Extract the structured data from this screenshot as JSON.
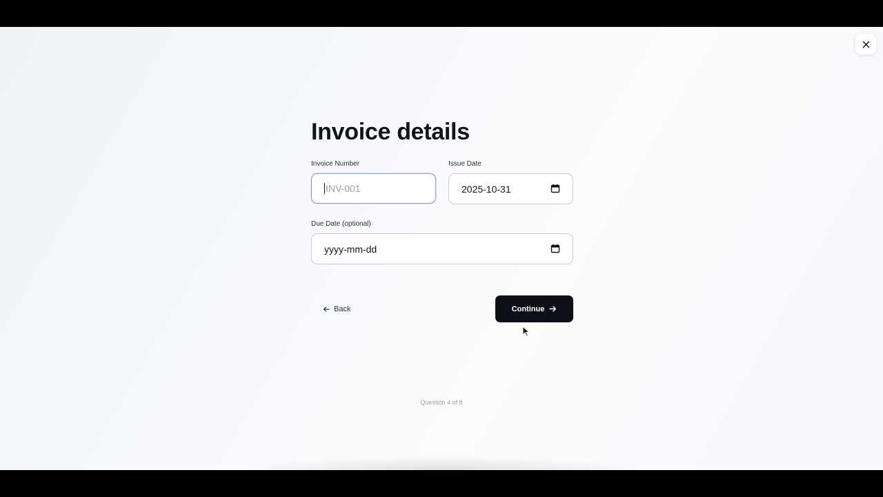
{
  "form": {
    "title": "Invoice details",
    "invoice_number": {
      "label": "Invoice Number",
      "placeholder": "INV-001",
      "value": ""
    },
    "issue_date": {
      "label": "Issue Date",
      "value": "2025-10-31"
    },
    "due_date": {
      "label": "Due Date (optional)",
      "placeholder": "yyyy-mm-dd",
      "value": ""
    }
  },
  "actions": {
    "back_label": "Back",
    "continue_label": "Continue"
  },
  "progress": {
    "text": "Question 4 of 8",
    "current": 4,
    "total": 8
  },
  "icons": {
    "close": "close-icon",
    "calendar": "calendar-icon",
    "back": "arrow-left-icon",
    "continue": "arrow-right-icon"
  },
  "colors": {
    "primary_button": "#0d1117",
    "focus_border": "#8fa2c2",
    "placeholder": "#9aa0a8"
  }
}
